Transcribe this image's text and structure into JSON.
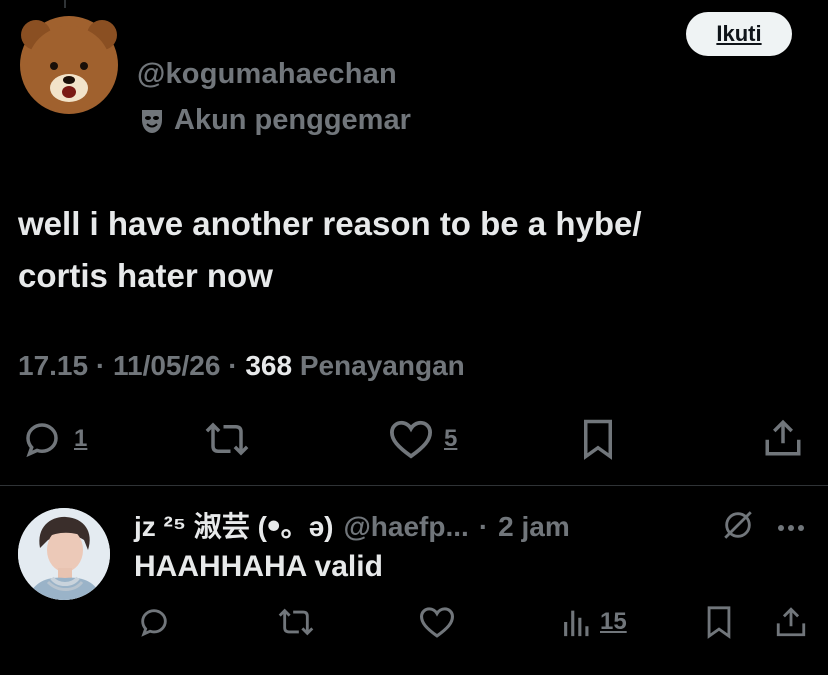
{
  "post": {
    "handle": "@kogumahaechan",
    "account_label": "Akun penggemar",
    "follow_label": "Ikuti",
    "text_line1": "well i have another reason to be a hybe/",
    "text_line2": "cortis hater now",
    "time": "17.15",
    "date": "11/05/26",
    "views_count": "368",
    "views_label": "Penayangan",
    "actions": {
      "reply_count": "1",
      "like_count": "5"
    }
  },
  "reply": {
    "name": "jz ²⁵ 淑芸 (ꔷ。ə)",
    "handle": "@haefp...",
    "time": "2 jam",
    "text": "HAAHHAHA valid",
    "views_count": "15"
  },
  "icons": {
    "account_label_icon": "theater-mask-icon",
    "reply": "reply-icon",
    "repost": "repost-icon",
    "like": "heart-icon",
    "bookmark": "bookmark-icon",
    "share": "share-icon",
    "views": "views-icon",
    "grok": "slash-circle-icon",
    "more": "more-icon"
  },
  "colors": {
    "background": "#000000",
    "text": "#e7e9ea",
    "muted": "#71767b",
    "follow_bg": "#eff3f4",
    "divider": "#2f3336"
  }
}
